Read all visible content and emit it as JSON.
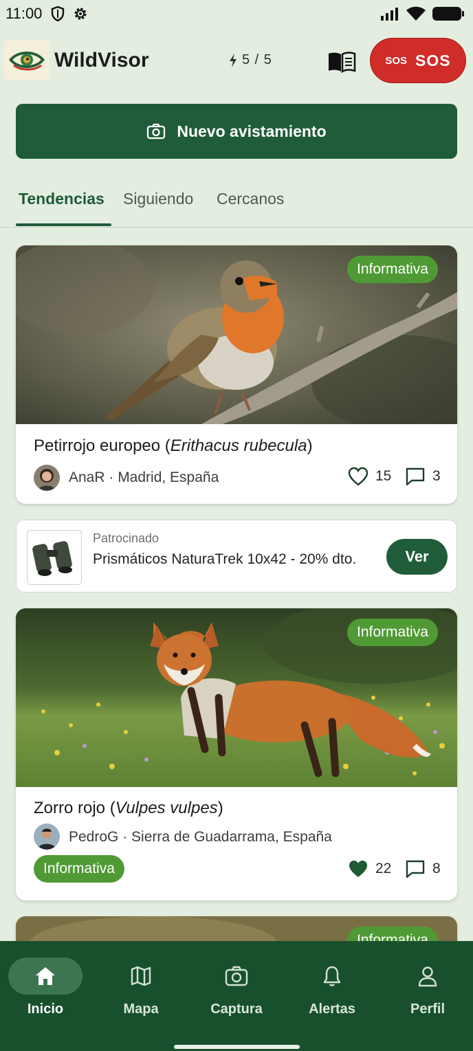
{
  "status_bar": {
    "time": "11:00"
  },
  "header": {
    "app_name": "WildVisor",
    "energy": "5 / 5",
    "sos_small": "SOS",
    "sos_label": "SOS"
  },
  "primary_action": {
    "label": "Nuevo avistamiento"
  },
  "tabs": [
    {
      "label": "Tendencias",
      "active": true
    },
    {
      "label": "Siguiendo",
      "active": false
    },
    {
      "label": "Cercanos",
      "active": false
    }
  ],
  "posts": [
    {
      "badge": "Informativa",
      "title_common": "Petirrojo europeo (",
      "title_scientific": "Erithacus rubecula",
      "title_close": ")",
      "author_meta": "AnaR · Madrid, España",
      "likes": "15",
      "comments": "3",
      "liked": false
    },
    {
      "badge": "Informativa",
      "title_common": "Zorro rojo (",
      "title_scientific": "Vulpes vulpes",
      "title_close": ")",
      "author_meta": "PedroG · Sierra de Guadarrama, España",
      "inline_badge": "Informativa",
      "likes": "22",
      "comments": "8",
      "liked": true
    },
    {
      "badge": "Informativa"
    }
  ],
  "sponsored": {
    "label": "Patrocinado",
    "description": "Prismáticos NaturaTrek 10x42 - 20% dto.",
    "button": "Ver"
  },
  "bottom_nav": [
    {
      "label": "Inicio",
      "icon": "home-icon",
      "active": true
    },
    {
      "label": "Mapa",
      "icon": "map-icon",
      "active": false
    },
    {
      "label": "Captura",
      "icon": "camera-icon",
      "active": false
    },
    {
      "label": "Alertas",
      "icon": "bell-icon",
      "active": false
    },
    {
      "label": "Perfil",
      "icon": "person-icon",
      "active": false
    }
  ],
  "colors": {
    "primary": "#205c39",
    "nav": "#18502e",
    "badge": "#4f9a35",
    "sos": "#d02c28",
    "background": "#e3eee1"
  }
}
